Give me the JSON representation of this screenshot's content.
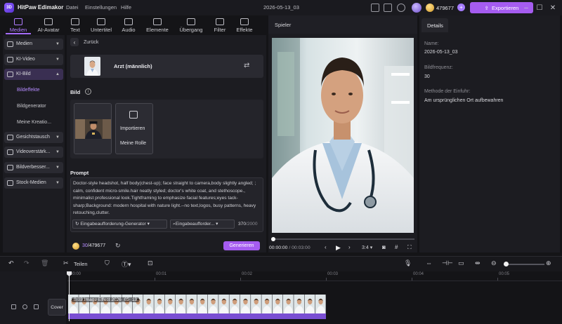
{
  "app": {
    "name": "HitPaw Edimakor",
    "menus": [
      "Datei",
      "Einstellungen",
      "Hilfe"
    ],
    "project_title": "2026-05-13_03",
    "credits": "479677",
    "export_label": "Exportieren"
  },
  "toolbar": {
    "tabs": [
      {
        "label": "Medien",
        "icon": "media-icon"
      },
      {
        "label": "AI-Avatar",
        "icon": "avatar-icon"
      },
      {
        "label": "Text",
        "icon": "text-icon"
      },
      {
        "label": "Untertitel",
        "icon": "subtitle-icon"
      },
      {
        "label": "Audio",
        "icon": "audio-icon"
      },
      {
        "label": "Elemente",
        "icon": "elements-icon"
      },
      {
        "label": "Übergang",
        "icon": "transition-icon"
      },
      {
        "label": "Filter",
        "icon": "filter-icon"
      },
      {
        "label": "Effekte",
        "icon": "effects-icon"
      }
    ],
    "active": "Medien"
  },
  "sidebar": {
    "items": [
      {
        "label": "Medien",
        "icon": "folder-icon"
      },
      {
        "label": "KI-Video",
        "icon": "ai-video-icon"
      },
      {
        "label": "KI-Bild",
        "icon": "ai-image-icon"
      },
      {
        "label": "Gesichtstausch",
        "icon": "faceswap-icon"
      },
      {
        "label": "Videoverstärk...",
        "icon": "video-enhance-icon"
      },
      {
        "label": "Bildverbesser...",
        "icon": "image-enhance-icon"
      },
      {
        "label": "Stock-Medien",
        "icon": "stock-icon"
      }
    ],
    "subitems": [
      "Bildeffekte",
      "Bildgenerator",
      "Meine Kreatio..."
    ],
    "active_subitem": "Bildeffekte"
  },
  "center": {
    "back_label": "Zurück",
    "role_name": "Arzt (männlich)",
    "bild_label": "Bild",
    "import_label": "Importieren",
    "my_role_label": "Meine Rolle",
    "prompt_label": "Prompt",
    "prompt_text": "Doctor-style  headshot, half body(chest-up); face straight to camera,body slightly angled; ; calm, confident micro-smile.hair neatly styled; doctor's white coat, and stethoscope., minimalist professional look.Tightframing to emphasize facial features;eyes tack-sharp;Background: modern hospital with nature light.--no text,logos, busy patterns, heavy retouching,clutter.",
    "dropdown1": "Eingabeaufforderung-Generator",
    "dropdown2": "Eingabeaufforder...",
    "char_count": "370",
    "char_max": "/2000",
    "cost_used": "30",
    "cost_total": "/479677",
    "generate_label": "Generieren"
  },
  "player": {
    "title": "Spieler",
    "time_current": "00:00:00",
    "time_total": "/ 00:03:00",
    "aspect": "3:4"
  },
  "details": {
    "tab": "Details",
    "name_label": "Name:",
    "name_value": "2026-05-13_03",
    "fps_label": "Bildfrequenz:",
    "fps_value": "30",
    "method_label": "Methode der Einfuhr:",
    "method_value": "Am ursprünglichen Ort aufbewahren"
  },
  "timeline": {
    "split_label": "Teilen",
    "ticks": [
      "00:00",
      "00:01",
      "00:02",
      "00:03",
      "00:04",
      "00:05"
    ],
    "cover_label": "Cover",
    "clip_label": "0:03  Image Effect 2026_05_13",
    "zoom_level": 0.05
  },
  "colors": {
    "accent": "#a55cf0",
    "accent_text": "#b07cff",
    "panel": "#1c1c21",
    "background": "#141417"
  }
}
